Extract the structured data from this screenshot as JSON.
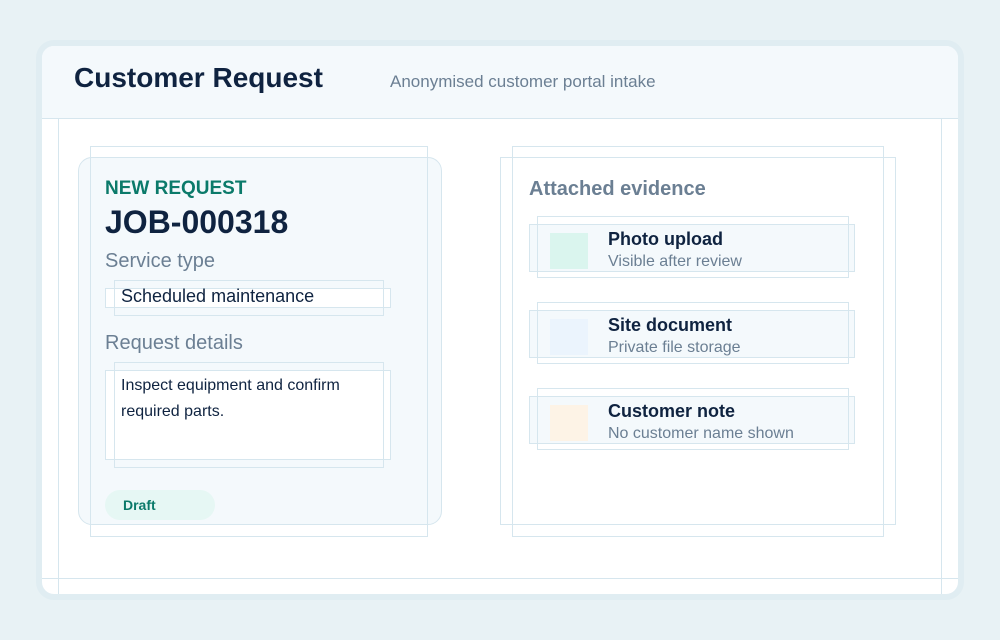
{
  "header": {
    "title": "Customer Request",
    "subtitle": "Anonymised customer portal intake"
  },
  "request": {
    "eyebrow": "NEW REQUEST",
    "job_id": "JOB-000318",
    "service_type_label": "Service type",
    "service_type_value": "Scheduled maintenance",
    "details_label": "Request details",
    "details_value": "Inspect equipment and confirm required parts.",
    "status": "Draft"
  },
  "evidence": {
    "title": "Attached evidence",
    "items": [
      {
        "title": "Photo upload",
        "subtitle": "Visible after review",
        "color": "#daf5ee",
        "icon": "image-icon"
      },
      {
        "title": "Site document",
        "subtitle": "Private file storage",
        "color": "#ebf4fd",
        "icon": "document-icon"
      },
      {
        "title": "Customer note",
        "subtitle": "No customer name shown",
        "color": "#fdf3e6",
        "icon": "note-icon"
      }
    ]
  },
  "colors": {
    "accent": "#0b7a6a",
    "heading": "#0f2340",
    "muted": "#6b7f93",
    "border": "#d6e6ee"
  }
}
